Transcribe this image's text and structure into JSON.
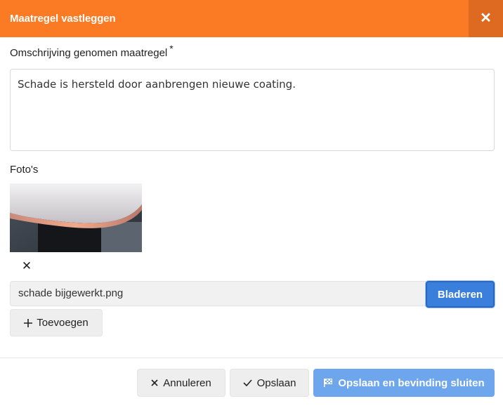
{
  "dialog": {
    "title": "Maatregel vastleggen",
    "close_glyph": "✕"
  },
  "description": {
    "label": "Omschrijving genomen maatregel",
    "required_marker": "*",
    "value": "Schade is hersteld door aanbrengen nieuwe coating."
  },
  "photos": {
    "label": "Foto's",
    "remove_glyph": "✕",
    "file_name": "schade bijgewerkt.png",
    "browse_label": "Bladeren",
    "add_label": "Toevoegen",
    "add_icon": "plus-icon"
  },
  "footer": {
    "cancel_label": "Annuleren",
    "save_label": "Opslaan",
    "save_close_label": "Opslaan en bevinding sluiten"
  },
  "colors": {
    "header_bg": "#fb7b24",
    "close_bg": "#de6a22",
    "primary": "#3a7fdc",
    "primary_light": "#6ea6ee"
  }
}
